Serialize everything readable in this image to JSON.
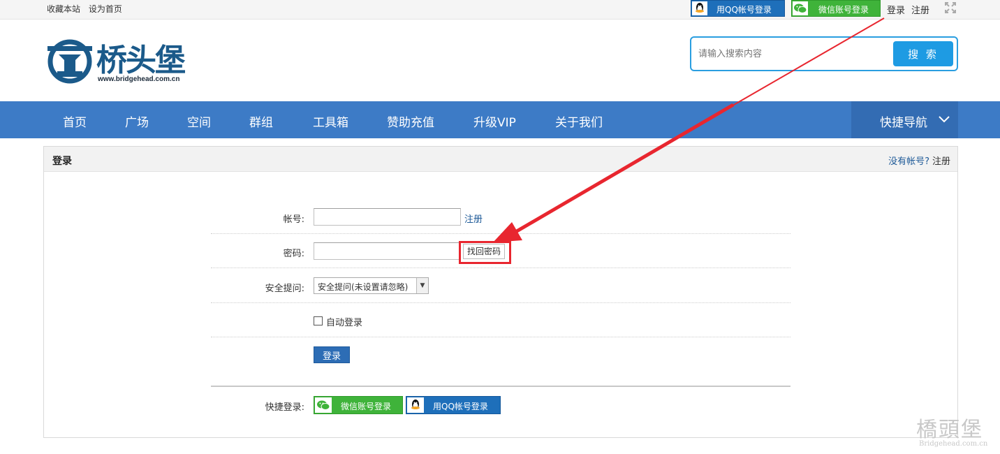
{
  "topbar": {
    "favorite": "收藏本站",
    "set_home": "设为首页",
    "qq_login": "用QQ帐号登录",
    "wechat_login": "微信账号登录",
    "login": "登录",
    "register": "注册"
  },
  "header": {
    "logo_text": "桥头堡",
    "logo_url": "www.bridgehead.com.cn",
    "search_placeholder": "请输入搜索内容",
    "search_button": "搜 索"
  },
  "nav": {
    "items": [
      "首页",
      "广场",
      "空间",
      "群组",
      "工具箱",
      "赞助充值",
      "升级VIP",
      "关于我们"
    ],
    "quick_nav": "快捷导航"
  },
  "panel": {
    "title": "登录",
    "no_account": "没有帐号?",
    "register": "注册"
  },
  "form": {
    "account_label": "帐号:",
    "account_register_link": "注册",
    "password_label": "密码:",
    "find_password": "找回密码",
    "security_label": "安全提问:",
    "security_selected": "安全提问(未设置请忽略)",
    "auto_login": "自动登录",
    "submit": "登录",
    "quick_login_label": "快捷登录:",
    "wechat_login": "微信账号登录",
    "qq_login": "用QQ帐号登录"
  },
  "annotation": {
    "color": "#e8262f"
  },
  "watermark": {
    "cn": "橋頭堡",
    "en": "Bridgehead.com.cn"
  }
}
